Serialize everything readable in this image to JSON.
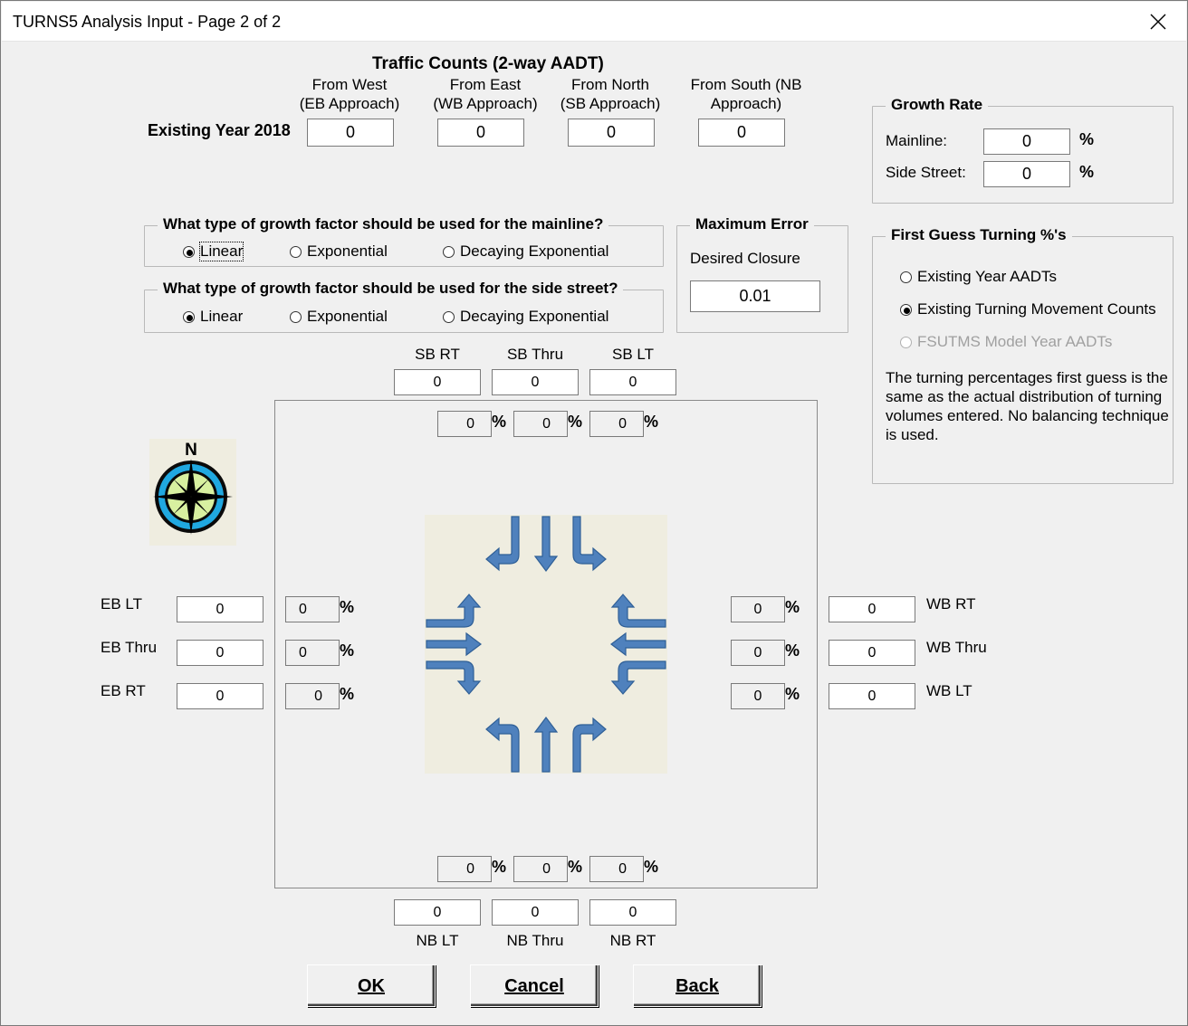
{
  "window": {
    "title": "TURNS5 Analysis Input - Page 2 of 2"
  },
  "traffic_counts": {
    "heading": "Traffic Counts (2-way AADT)",
    "columns": [
      {
        "line1": "From West",
        "line2": "(EB Approach)"
      },
      {
        "line1": "From East",
        "line2": "(WB Approach)"
      },
      {
        "line1": "From North",
        "line2": "(SB Approach)"
      },
      {
        "line1": "From South (NB",
        "line2": "Approach)"
      }
    ],
    "row_label": "Existing Year 2018",
    "values": [
      "0",
      "0",
      "0",
      "0"
    ]
  },
  "growth_rate": {
    "title": "Growth Rate",
    "mainline_label": "Mainline:",
    "mainline_value": "0",
    "side_label": "Side Street:",
    "side_value": "0",
    "unit": "%"
  },
  "mainline_growth": {
    "title": "What type of growth factor should be used for the mainline?",
    "options": [
      "Linear",
      "Exponential",
      "Decaying Exponential"
    ],
    "selected": "Linear"
  },
  "side_growth": {
    "title": "What type of growth factor should be used for the side street?",
    "options": [
      "Linear",
      "Exponential",
      "Decaying Exponential"
    ],
    "selected": "Linear"
  },
  "max_error": {
    "title": "Maximum Error",
    "label": "Desired Closure",
    "value": "0.01"
  },
  "first_guess": {
    "title": "First Guess Turning %'s",
    "options": [
      "Existing Year AADTs",
      "Existing Turning Movement Counts",
      "FSUTMS Model Year AADTs"
    ],
    "selected": "Existing Turning Movement Counts",
    "disabled": "FSUTMS Model Year AADTs",
    "description": "The turning percentages first guess is the same as the actual distribution of turning volumes entered. No balancing technique is used."
  },
  "pct_symbol": "%",
  "sb": {
    "labels": [
      "SB RT",
      "SB Thru",
      "SB LT"
    ],
    "counts": [
      "0",
      "0",
      "0"
    ],
    "pcts": [
      "0",
      "0",
      "0"
    ]
  },
  "nb": {
    "labels": [
      "NB LT",
      "NB Thru",
      "NB RT"
    ],
    "counts": [
      "0",
      "0",
      "0"
    ],
    "pcts": [
      "0",
      "0",
      "0"
    ]
  },
  "eb": {
    "labels": [
      "EB LT",
      "EB Thru",
      "EB RT"
    ],
    "counts": [
      "0",
      "0",
      "0"
    ],
    "pcts": [
      "0",
      "0",
      "0"
    ]
  },
  "wb": {
    "labels": [
      "WB RT",
      "WB Thru",
      "WB LT"
    ],
    "counts": [
      "0",
      "0",
      "0"
    ],
    "pcts": [
      "0",
      "0",
      "0"
    ]
  },
  "compass_letter": "N",
  "icons": {
    "compass": "compass-icon",
    "close": "close-icon",
    "intersection": "intersection-arrows-icon"
  },
  "colors": {
    "arrow": "#4f81bd",
    "arrow_stroke": "#2f5f96",
    "diagram_bg": "#efede0"
  },
  "buttons": {
    "ok": "OK",
    "cancel": "Cancel",
    "back": "Back"
  }
}
